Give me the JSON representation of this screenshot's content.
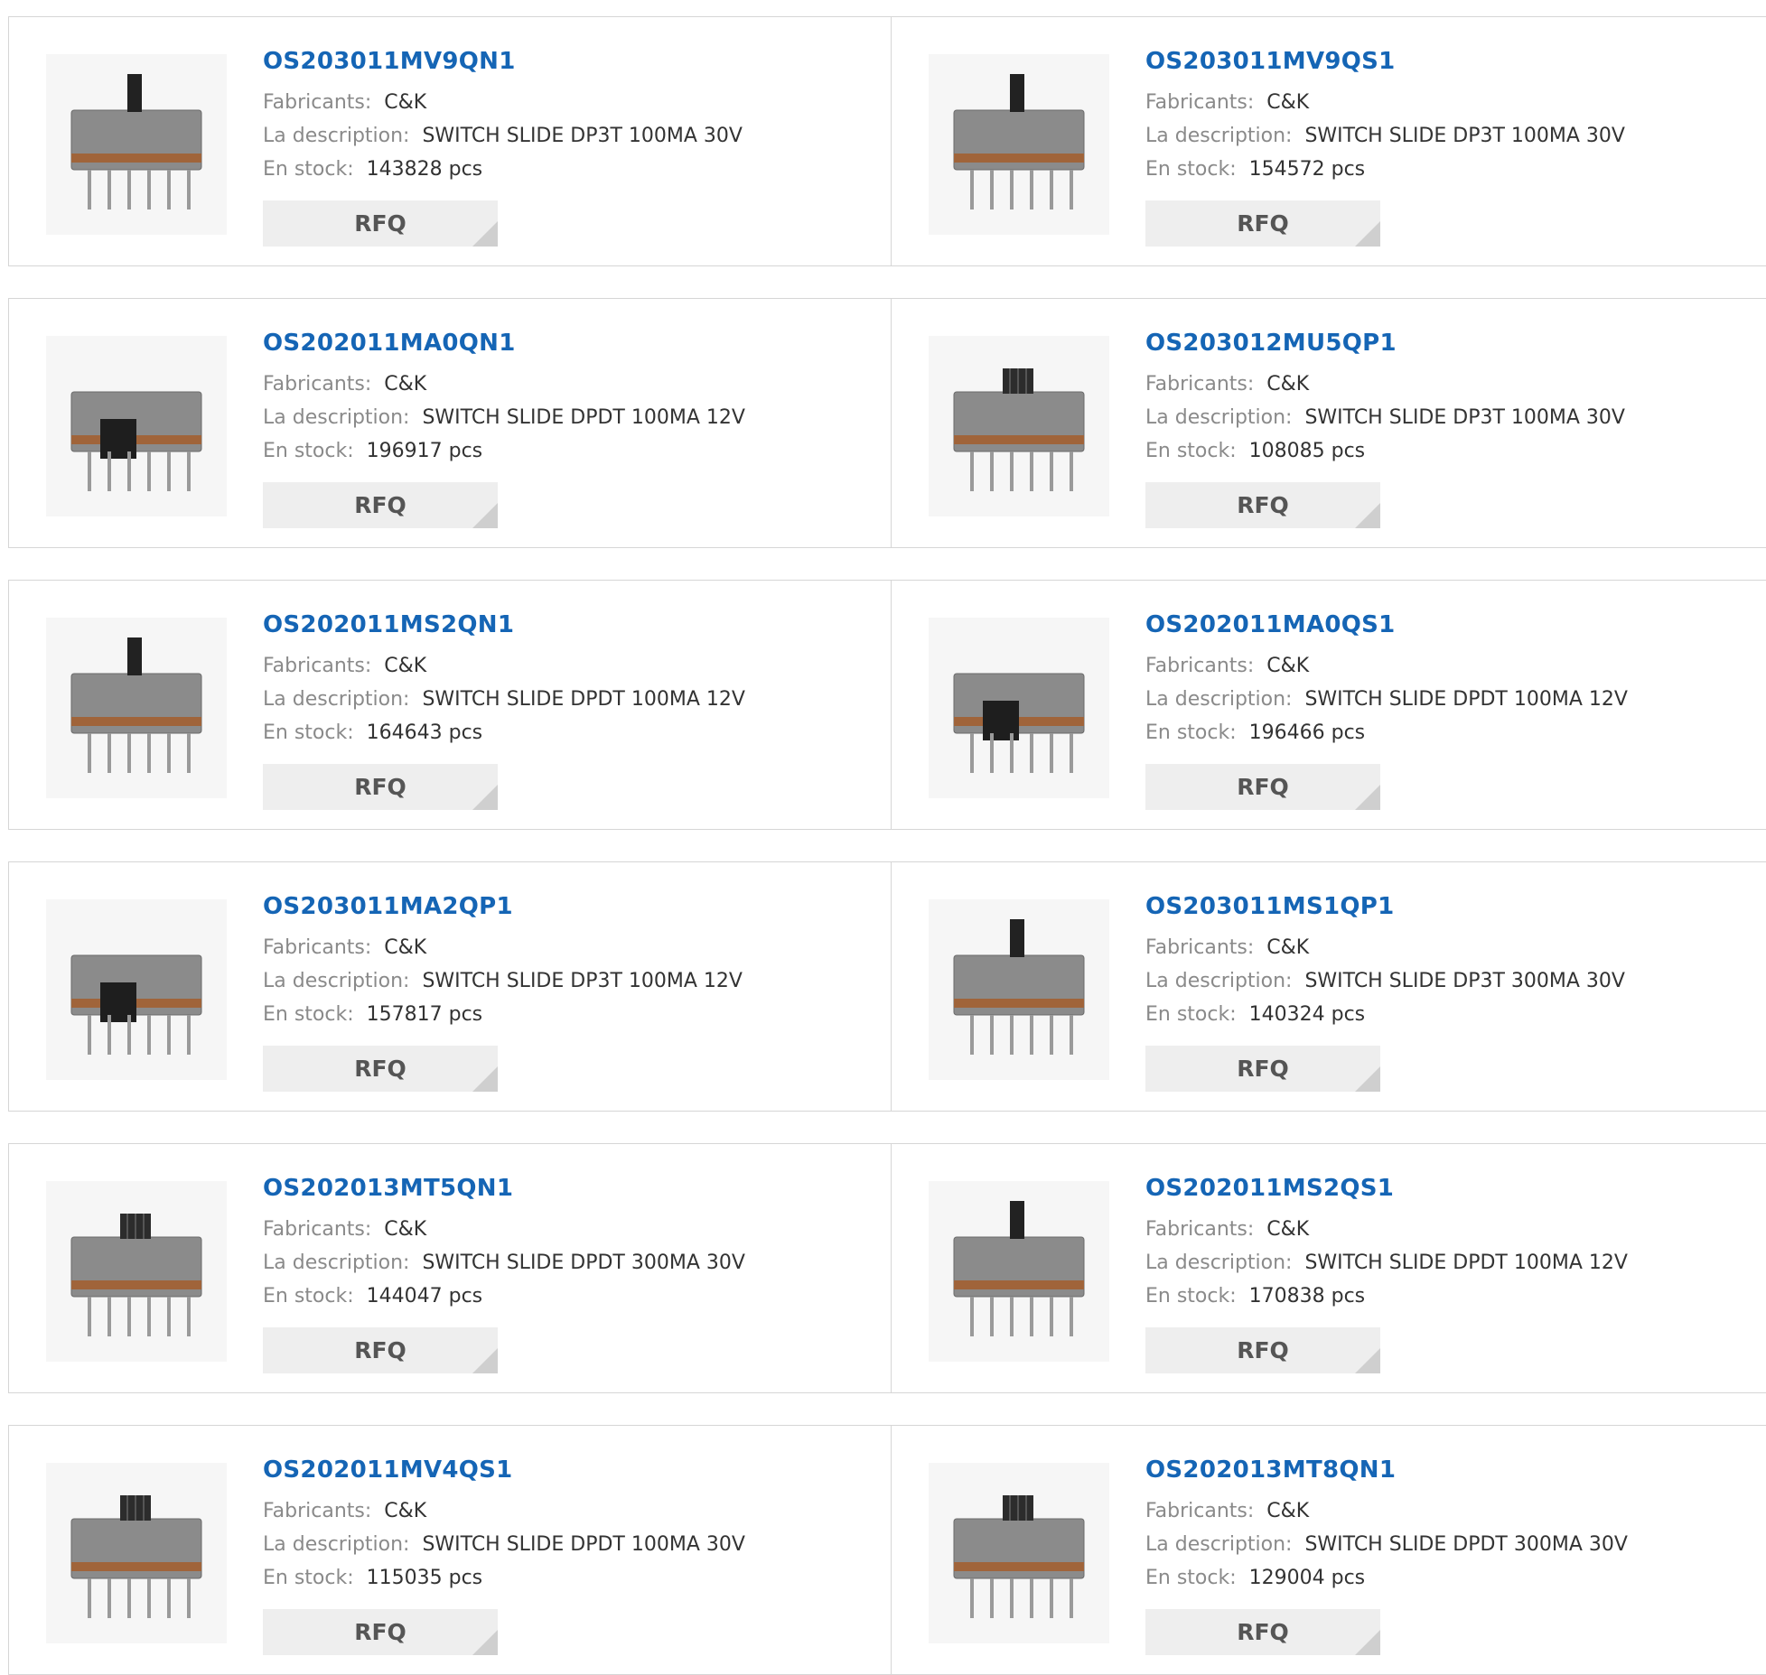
{
  "labels": {
    "manufacturer": "Fabricants:",
    "description": "La description:",
    "stock": "En stock:",
    "rfq": "RFQ"
  },
  "products": [
    {
      "part": "OS203011MV9QN1",
      "manufacturer": "C&K",
      "description": "SWITCH SLIDE DP3T 100MA 30V",
      "stock": "143828 pcs",
      "image": "slide-switch-vertical"
    },
    {
      "part": "OS203011MV9QS1",
      "manufacturer": "C&K",
      "description": "SWITCH SLIDE DP3T 100MA 30V",
      "stock": "154572 pcs",
      "image": "slide-switch-vertical"
    },
    {
      "part": "OS202011MA0QN1",
      "manufacturer": "C&K",
      "description": "SWITCH SLIDE DPDT 100MA 12V",
      "stock": "196917 pcs",
      "image": "slide-switch-right-angle"
    },
    {
      "part": "OS203012MU5QP1",
      "manufacturer": "C&K",
      "description": "SWITCH SLIDE DP3T 100MA 30V",
      "stock": "108085 pcs",
      "image": "slide-switch-ribbed"
    },
    {
      "part": "OS202011MS2QN1",
      "manufacturer": "C&K",
      "description": "SWITCH SLIDE DPDT 100MA 12V",
      "stock": "164643 pcs",
      "image": "slide-switch-vertical"
    },
    {
      "part": "OS202011MA0QS1",
      "manufacturer": "C&K",
      "description": "SWITCH SLIDE DPDT 100MA 12V",
      "stock": "196466 pcs",
      "image": "slide-switch-right-angle"
    },
    {
      "part": "OS203011MA2QP1",
      "manufacturer": "C&K",
      "description": "SWITCH SLIDE DP3T 100MA 12V",
      "stock": "157817 pcs",
      "image": "slide-switch-right-angle"
    },
    {
      "part": "OS203011MS1QP1",
      "manufacturer": "C&K",
      "description": "SWITCH SLIDE DP3T 300MA 30V",
      "stock": "140324 pcs",
      "image": "slide-switch-vertical"
    },
    {
      "part": "OS202013MT5QN1",
      "manufacturer": "C&K",
      "description": "SWITCH SLIDE DPDT 300MA 30V",
      "stock": "144047 pcs",
      "image": "slide-switch-ribbed"
    },
    {
      "part": "OS202011MS2QS1",
      "manufacturer": "C&K",
      "description": "SWITCH SLIDE DPDT 100MA 12V",
      "stock": "170838 pcs",
      "image": "slide-switch-vertical"
    },
    {
      "part": "OS202011MV4QS1",
      "manufacturer": "C&K",
      "description": "SWITCH SLIDE DPDT 100MA 30V",
      "stock": "115035 pcs",
      "image": "slide-switch-ribbed"
    },
    {
      "part": "OS202013MT8QN1",
      "manufacturer": "C&K",
      "description": "SWITCH SLIDE DPDT 300MA 30V",
      "stock": "129004 pcs",
      "image": "slide-switch-ribbed"
    }
  ]
}
